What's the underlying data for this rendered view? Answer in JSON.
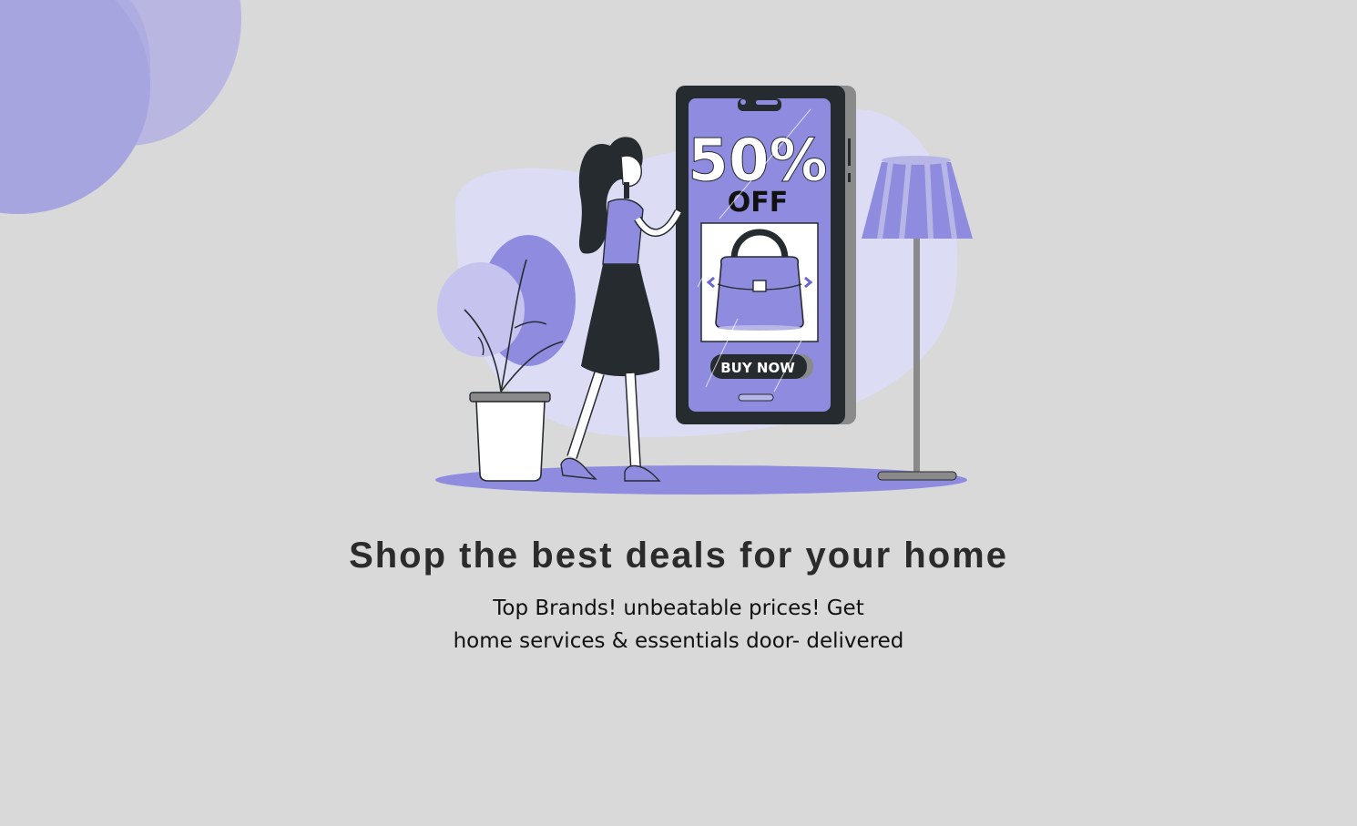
{
  "screen": {
    "headline": "Shop the best deals for your home",
    "subline_1": "Top Brands! unbeatable prices! Get",
    "subline_2": "home services & essentials door- delivered"
  },
  "illustration": {
    "promo_big": "50%",
    "promo_small": "OFF",
    "cta": "BUY NOW",
    "icons": [
      "shopping-bag-icon",
      "chevron-left-icon",
      "chevron-right-icon"
    ]
  },
  "colors": {
    "background": "#d9d9d9",
    "accent": "#8f8ce0",
    "accent_light": "#dcdcf5",
    "accent_mid": "#b8b6e6",
    "dark": "#262b30",
    "text": "#2b2b2b"
  }
}
